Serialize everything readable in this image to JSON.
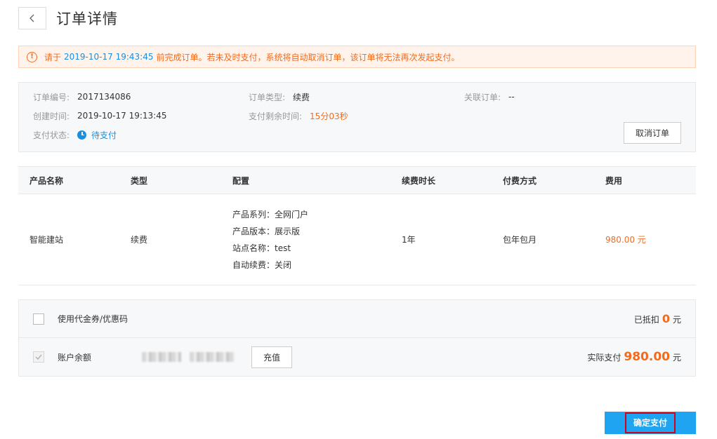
{
  "header": {
    "back_icon": "chevron-left-icon",
    "title": "订单详情"
  },
  "notice": {
    "prefix": "请于",
    "deadline": "2019-10-17 19:43:45",
    "suffix": "前完成订单。若未及时支付，系统将自动取消订单，该订单将无法再次发起支付。",
    "color": "#f26b1d"
  },
  "order_info": {
    "order_no_label": "订单编号:",
    "order_no": "2017134086",
    "created_label": "创建时间:",
    "created": "2019-10-17 19:13:45",
    "status_label": "支付状态:",
    "status": "待支付",
    "type_label": "订单类型:",
    "type": "续费",
    "remaining_label": "支付剩余时间:",
    "remaining": "15分03秒",
    "related_label": "关联订单:",
    "related": "--",
    "cancel_label": "取消订单"
  },
  "table": {
    "headers": [
      "产品名称",
      "类型",
      "配置",
      "续费时长",
      "付费方式",
      "费用"
    ],
    "rows": [
      {
        "name": "智能建站",
        "type": "续费",
        "config": [
          "产品系列：全网门户",
          "产品版本：展示版",
          "站点名称：test",
          "自动续费：关闭"
        ],
        "duration": "1年",
        "billing": "包年包月",
        "fee": "980.00 元"
      }
    ]
  },
  "payment": {
    "coupon_label": "使用代金券/优惠码",
    "deducted_label": "已抵扣",
    "deducted_value": "0",
    "unit": "元",
    "balance_label": "账户余额",
    "recharge_label": "充值",
    "actual_label": "实际支付",
    "actual_value": "980.00"
  },
  "confirm_label": "确定支付",
  "colors": {
    "accent_blue": "#1ea4f0",
    "link_blue": "#1a8fe0",
    "orange": "#f26b1d"
  }
}
